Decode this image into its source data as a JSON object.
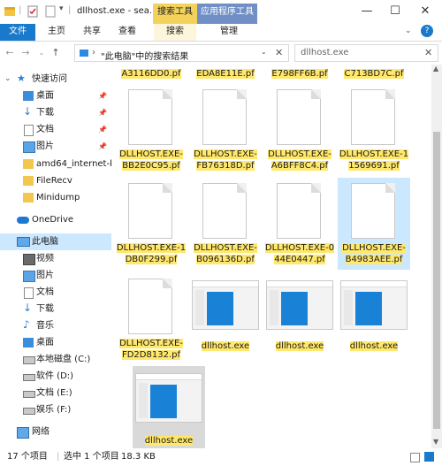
{
  "titlebar": {
    "title": "dllhost.exe - sea...",
    "search_tools_tab": "搜索工具",
    "app_tools_tab": "应用程序工具",
    "minimize": "—",
    "maximize": "☐",
    "close": "✕",
    "colors": {
      "search_tools": "#f3d25b",
      "app_tools": "#6f8fc5"
    }
  },
  "ribbon": {
    "file_tab": "文件",
    "tabs": [
      "主页",
      "共享",
      "查看",
      "搜索",
      "管理"
    ],
    "help": "?"
  },
  "address": {
    "path": "\"此电脑\"中的搜索结果",
    "search_value": "dllhost.exe"
  },
  "nav": {
    "quick_access": "快速访问",
    "pinned": [
      {
        "label": "桌面",
        "icon": "desktop-folder-icon"
      },
      {
        "label": "下载",
        "icon": "download-icon"
      },
      {
        "label": "文档",
        "icon": "documents-icon"
      },
      {
        "label": "图片",
        "icon": "pictures-icon"
      }
    ],
    "folders": [
      "amd64_internet-b",
      "FileRecv",
      "Minidump"
    ],
    "onedrive": "OneDrive",
    "this_pc": "此电脑",
    "pc_items": [
      {
        "label": "视频",
        "icon": "video-icon"
      },
      {
        "label": "图片",
        "icon": "pictures-icon"
      },
      {
        "label": "文档",
        "icon": "documents-icon"
      },
      {
        "label": "下载",
        "icon": "download-icon"
      },
      {
        "label": "音乐",
        "icon": "music-icon"
      },
      {
        "label": "桌面",
        "icon": "desktop-folder-icon"
      },
      {
        "label": "本地磁盘 (C:)",
        "icon": "system-drive-icon"
      },
      {
        "label": "软件 (D:)",
        "icon": "drive-icon"
      },
      {
        "label": "文档 (E:)",
        "icon": "drive-icon"
      },
      {
        "label": "娱乐 (F:)",
        "icon": "drive-icon"
      }
    ],
    "network": "网络"
  },
  "files": {
    "top_row": [
      "A3116DD0.pf",
      "EDA8E11E.pf",
      "E798FF6B.pf",
      "C713BD7C.pf"
    ],
    "row1": [
      {
        "l1": "DLLHOST.EXE-",
        "l2": "BB2E0C95.pf"
      },
      {
        "l1": "DLLHOST.EXE-",
        "l2": "FB76318D.pf"
      },
      {
        "l1": "DLLHOST.EXE-",
        "l2": "A6BFF8C4.pf"
      },
      {
        "l1": "DLLHOST.EXE-1",
        "l2": "1569691.pf"
      }
    ],
    "row2": [
      {
        "l1": "DLLHOST.EXE-1",
        "l2": "DB0F299.pf"
      },
      {
        "l1": "DLLHOST.EXE-",
        "l2": "B096136D.pf"
      },
      {
        "l1": "DLLHOST.EXE-0",
        "l2": "44E0447.pf"
      },
      {
        "l1": "DLLHOST.EXE-",
        "l2": "B4983AEE.pf"
      }
    ],
    "row3": [
      {
        "l1": "DLLHOST.EXE-",
        "l2": "FD2D8132.pf"
      },
      {
        "l1": "dllhost.exe"
      },
      {
        "l1": "dllhost.exe"
      },
      {
        "l1": "dllhost.exe"
      }
    ],
    "row4": [
      {
        "l1": "dllhost.exe"
      }
    ]
  },
  "status": {
    "count": "17 个项目",
    "selected": "选中 1 个项目",
    "size": "18.3 KB"
  }
}
